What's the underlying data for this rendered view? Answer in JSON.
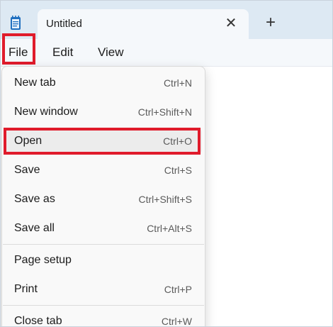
{
  "tab": {
    "title": "Untitled",
    "close_glyph": "✕",
    "new_tab_glyph": "+"
  },
  "menubar": {
    "items": [
      "File",
      "Edit",
      "View"
    ]
  },
  "file_menu": {
    "items": [
      {
        "label": "New tab",
        "shortcut": "Ctrl+N"
      },
      {
        "label": "New window",
        "shortcut": "Ctrl+Shift+N"
      },
      {
        "label": "Open",
        "shortcut": "Ctrl+O"
      },
      {
        "label": "Save",
        "shortcut": "Ctrl+S"
      },
      {
        "label": "Save as",
        "shortcut": "Ctrl+Shift+S"
      },
      {
        "label": "Save all",
        "shortcut": "Ctrl+Alt+S"
      },
      {
        "label": "Page setup",
        "shortcut": ""
      },
      {
        "label": "Print",
        "shortcut": "Ctrl+P"
      },
      {
        "label": "Close tab",
        "shortcut": "Ctrl+W"
      }
    ]
  },
  "icons": {
    "app": "notepad-icon",
    "close": "close-icon",
    "add": "plus-icon"
  },
  "colors": {
    "highlight": "#e01b2b",
    "titlebar": "#dde9f3",
    "menu_bg": "#f9f9f9"
  }
}
